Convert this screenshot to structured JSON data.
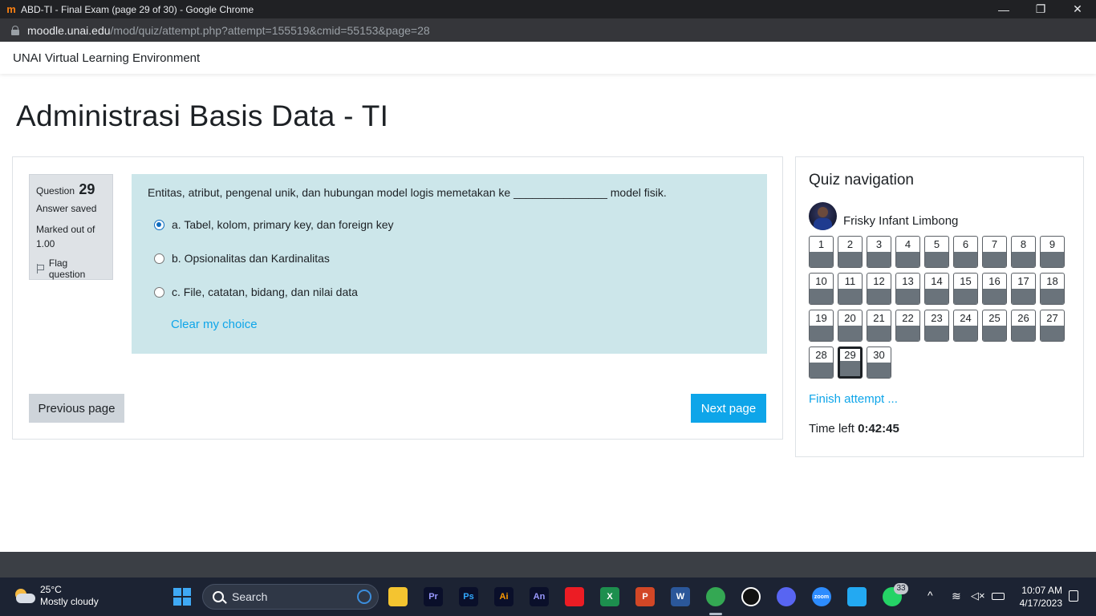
{
  "browser": {
    "tab_title": "ABD-TI - Final Exam (page 29 of 30) - Google Chrome",
    "url_host": "moodle.unai.edu",
    "url_path": "/mod/quiz/attempt.php?attempt=155519&cmid=55153&page=28",
    "controls": {
      "minimize": "—",
      "restore": "❐",
      "close": "✕"
    }
  },
  "site": {
    "name": "UNAI Virtual Learning Environment"
  },
  "page": {
    "title": "Administrasi Basis Data - TI"
  },
  "question": {
    "label": "Question",
    "number": "29",
    "state": "Answer saved",
    "grade": "Marked out of 1.00",
    "flag_label": "Flag question",
    "text": "Entitas, atribut, pengenal unik, dan hubungan model logis memetakan ke _______________ model fisik.",
    "answers": [
      {
        "label": "a. Tabel, kolom, primary key, dan foreign key",
        "checked": true
      },
      {
        "label": "b. Opsionalitas dan Kardinalitas",
        "checked": false
      },
      {
        "label": "c. File, catatan, bidang, dan nilai data",
        "checked": false
      }
    ],
    "clear_choice": "Clear my choice"
  },
  "buttons": {
    "previous": "Previous page",
    "next": "Next page"
  },
  "quiz_nav": {
    "title": "Quiz navigation",
    "user_name": "Frisky Infant Limbong",
    "questions": [
      "1",
      "2",
      "3",
      "4",
      "5",
      "6",
      "7",
      "8",
      "9",
      "10",
      "11",
      "12",
      "13",
      "14",
      "15",
      "16",
      "17",
      "18",
      "19",
      "20",
      "21",
      "22",
      "23",
      "24",
      "25",
      "26",
      "27",
      "28",
      "29",
      "30"
    ],
    "current": "29",
    "finish": "Finish attempt ...",
    "time_label": "Time left",
    "time_value": "0:42:45"
  },
  "taskbar": {
    "weather_temp": "25°C",
    "weather_desc": "Mostly cloudy",
    "search_placeholder": "Search",
    "notification_count": "33",
    "time": "10:07 AM",
    "date": "4/17/2023",
    "apps": [
      {
        "name": "file-explorer",
        "label": "",
        "color": "#f4c430"
      },
      {
        "name": "premiere",
        "label": "Pr",
        "color": "#9999ff"
      },
      {
        "name": "photoshop",
        "label": "Ps",
        "color": "#31a8ff"
      },
      {
        "name": "illustrator",
        "label": "Ai",
        "color": "#ff9a00"
      },
      {
        "name": "animate",
        "label": "An",
        "color": "#9a9aff"
      },
      {
        "name": "acrobat",
        "label": "",
        "color": "#ec1c24"
      },
      {
        "name": "excel",
        "label": "X",
        "color": "#1d8f4e"
      },
      {
        "name": "powerpoint",
        "label": "P",
        "color": "#d24726"
      },
      {
        "name": "word",
        "label": "W",
        "color": "#2b579a"
      },
      {
        "name": "chrome",
        "label": "",
        "color": "#34a853"
      },
      {
        "name": "obs",
        "label": "",
        "color": "#ffffff"
      },
      {
        "name": "discord",
        "label": "",
        "color": "#5865f2"
      },
      {
        "name": "zoom",
        "label": "zoom",
        "color": "#2d8cff"
      },
      {
        "name": "vscode",
        "label": "",
        "color": "#23a9f2"
      },
      {
        "name": "whatsapp",
        "label": "",
        "color": "#25d366"
      }
    ]
  }
}
